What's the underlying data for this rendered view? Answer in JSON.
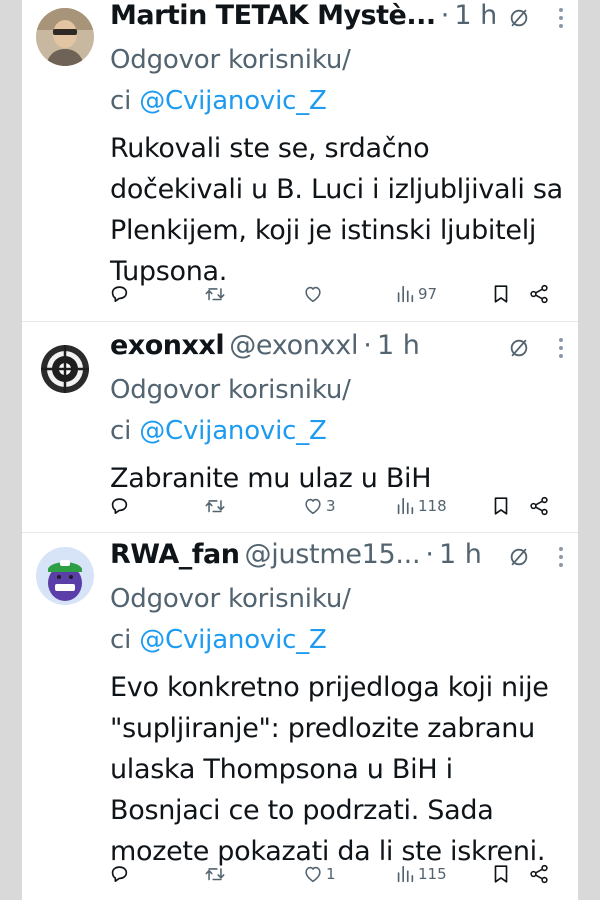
{
  "colors": {
    "accent": "#1d9bf0",
    "muted": "#536471",
    "text": "#0f1419"
  },
  "tweets": [
    {
      "display_name": "Martin TETAK Mystè...",
      "handle": "",
      "dot": "·",
      "time": "1 h",
      "reply_label_1": "Odgovor korisniku/",
      "reply_label_2": "ci",
      "reply_mention": "@Cvijanovic_Z",
      "text": "Rukovali ste se, srdačno dočekivali u B. Luci i izljubljivali sa Plenkijem, koji je istinski ljubitelj Tupsona.",
      "likes": "",
      "views": "97"
    },
    {
      "display_name": "exonxxl",
      "handle": "@exonxxl",
      "dot": "·",
      "time": "1 h",
      "reply_label_1": "Odgovor korisniku/",
      "reply_label_2": "ci",
      "reply_mention": "@Cvijanovic_Z",
      "text": "Zabranite mu ulaz u BiH",
      "likes": "3",
      "views": "118"
    },
    {
      "display_name": "RWA_fan",
      "handle": "@justme15...",
      "dot": "·",
      "time": "1 h",
      "reply_label_1": "Odgovor korisniku/",
      "reply_label_2": "ci",
      "reply_mention": "@Cvijanovic_Z",
      "text": "Evo konkretno prijedloga koji nije \"supljiranje\": predlozite zabranu ulaska Thompsona u BiH i Bosnjaci ce to podrzati. Sada mozete pokazati da li ste iskreni.",
      "likes": "1",
      "views": "115"
    }
  ],
  "icons": [
    "reply-icon",
    "retweet-icon",
    "like-icon",
    "views-icon",
    "bookmark-icon",
    "share-icon",
    "grok-icon",
    "more-icon"
  ]
}
